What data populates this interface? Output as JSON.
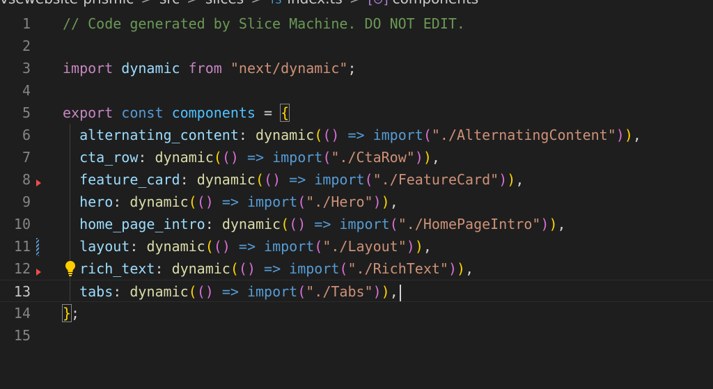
{
  "breadcrumb": {
    "items": [
      "vsewebsite-prismic",
      "src",
      "slices",
      "index.ts",
      "components"
    ],
    "separator": ">",
    "file_icon": "TS",
    "symbol_icon": "[⊙]"
  },
  "editor": {
    "current_line": 13,
    "lines": [
      {
        "num": "1",
        "text": "// Code generated by Slice Machine. DO NOT EDIT."
      },
      {
        "num": "2",
        "text": ""
      },
      {
        "num": "3",
        "import_kw": "import",
        "name": "dynamic",
        "from_kw": "from",
        "module": "\"next/dynamic\"",
        "semi": ";"
      },
      {
        "num": "4",
        "text": ""
      },
      {
        "num": "5",
        "export_kw": "export",
        "const_kw": "const",
        "name": "components",
        "eq": " = ",
        "open": "{"
      },
      {
        "num": "6",
        "key": "alternating_content",
        "path": "\"./AlternatingContent\""
      },
      {
        "num": "7",
        "key": "cta_row",
        "path": "\"./CtaRow\""
      },
      {
        "num": "8",
        "key": "feature_card",
        "path": "\"./FeatureCard\""
      },
      {
        "num": "9",
        "key": "hero",
        "path": "\"./Hero\""
      },
      {
        "num": "10",
        "key": "home_page_intro",
        "path": "\"./HomePageIntro\""
      },
      {
        "num": "11",
        "key": "layout",
        "path": "\"./Layout\""
      },
      {
        "num": "12",
        "key": "rich_text",
        "path": "\"./RichText\""
      },
      {
        "num": "13",
        "key": "tabs",
        "path": "\"./Tabs\""
      },
      {
        "num": "14",
        "close": "}",
        "semi": ";"
      },
      {
        "num": "15",
        "text": ""
      }
    ],
    "tokens": {
      "colon": ": ",
      "dynamic": "dynamic",
      "paren_open": "(",
      "arrow_params": "()",
      "arrow": " => ",
      "import_kw": "import",
      "paren_close": ")",
      "comma": ","
    }
  },
  "colors": {
    "background": "#1e1e1e",
    "comment": "#6a9955",
    "keyword": "#c586c0",
    "string": "#ce9178",
    "function": "#dcdcaa",
    "error_marker": "#f14c4c",
    "lightbulb": "#ffcc00"
  }
}
